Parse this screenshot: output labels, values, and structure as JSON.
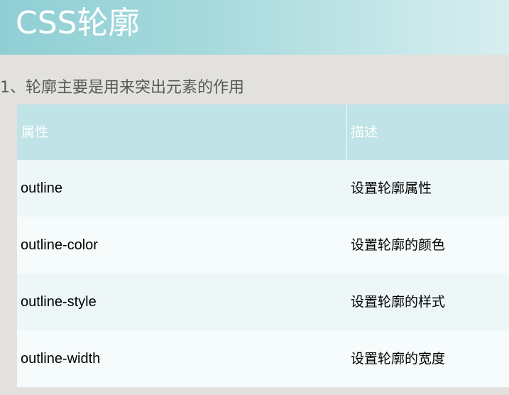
{
  "slide": {
    "title": "CSS轮廓",
    "subtitle": "1、轮廓主要是用来突出元素的作用"
  },
  "table": {
    "headers": [
      "属性",
      "描述"
    ],
    "rows": [
      {
        "property": "outline",
        "description": "设置轮廓属性"
      },
      {
        "property": "outline-color",
        "description": "设置轮廓的颜色"
      },
      {
        "property": "outline-style",
        "description": "设置轮廓的样式"
      },
      {
        "property": "outline-width",
        "description": "设置轮廓的宽度"
      }
    ]
  },
  "colors": {
    "title_bar_start": "#8fcfd4",
    "title_bar_end": "#d7eeef",
    "header_bg": "#bfe3e6",
    "row_odd_bg": "#eef7f8",
    "row_even_bg": "#f6fbfb",
    "page_bg": "#e3e1de"
  }
}
